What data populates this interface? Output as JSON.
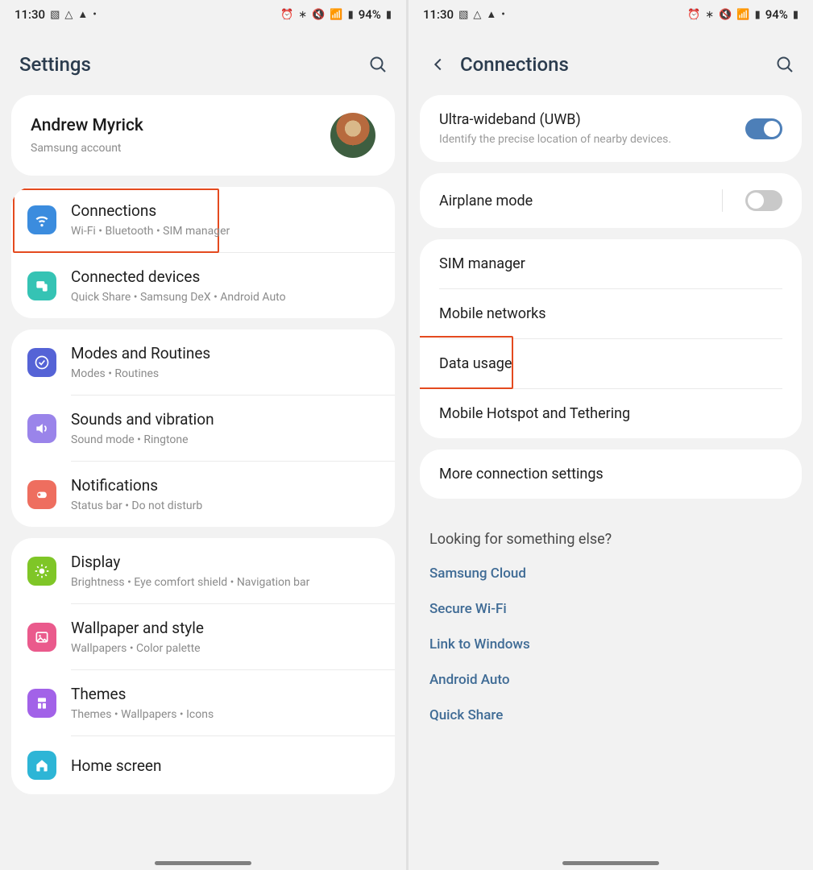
{
  "status": {
    "time": "11:30",
    "battery": "94%"
  },
  "left": {
    "title": "Settings",
    "account": {
      "name": "Andrew Myrick",
      "sub": "Samsung account"
    },
    "groups": [
      {
        "items": [
          {
            "icon": "wifi",
            "color": "#3b8cde",
            "label": "Connections",
            "sub": "Wi-Fi  •  Bluetooth  •  SIM manager",
            "highlight": true
          },
          {
            "icon": "devices",
            "color": "#35c3b4",
            "label": "Connected devices",
            "sub": "Quick Share  •  Samsung DeX  •  Android Auto"
          }
        ]
      },
      {
        "items": [
          {
            "icon": "check",
            "color": "#5563d6",
            "label": "Modes and Routines",
            "sub": "Modes  •  Routines"
          },
          {
            "icon": "sound",
            "color": "#9a84ea",
            "label": "Sounds and vibration",
            "sub": "Sound mode  •  Ringtone"
          },
          {
            "icon": "bell",
            "color": "#ee6e5f",
            "label": "Notifications",
            "sub": "Status bar  •  Do not disturb"
          }
        ]
      },
      {
        "items": [
          {
            "icon": "sun",
            "color": "#7fc627",
            "label": "Display",
            "sub": "Brightness  •  Eye comfort shield  •  Navigation bar"
          },
          {
            "icon": "image",
            "color": "#ea5a8c",
            "label": "Wallpaper and style",
            "sub": "Wallpapers  •  Color palette"
          },
          {
            "icon": "theme",
            "color": "#a262e8",
            "label": "Themes",
            "sub": "Themes  •  Wallpapers  •  Icons"
          },
          {
            "icon": "home",
            "color": "#2db5d6",
            "label": "Home screen",
            "sub": ""
          }
        ]
      }
    ]
  },
  "right": {
    "title": "Connections",
    "cards": [
      {
        "rows": [
          {
            "title": "Ultra-wideband (UWB)",
            "sub": "Identify the precise location of nearby devices.",
            "toggle": "on"
          }
        ]
      },
      {
        "rows": [
          {
            "title": "Airplane mode",
            "toggle": "off",
            "sep": true
          }
        ]
      },
      {
        "rows": [
          {
            "title": "SIM manager"
          },
          {
            "title": "Mobile networks"
          },
          {
            "title": "Data usage",
            "highlight": true
          },
          {
            "title": "Mobile Hotspot and Tethering"
          }
        ]
      },
      {
        "rows": [
          {
            "title": "More connection settings"
          }
        ]
      }
    ],
    "looking": {
      "heading": "Looking for something else?",
      "links": [
        "Samsung Cloud",
        "Secure Wi-Fi",
        "Link to Windows",
        "Android Auto",
        "Quick Share"
      ]
    }
  }
}
